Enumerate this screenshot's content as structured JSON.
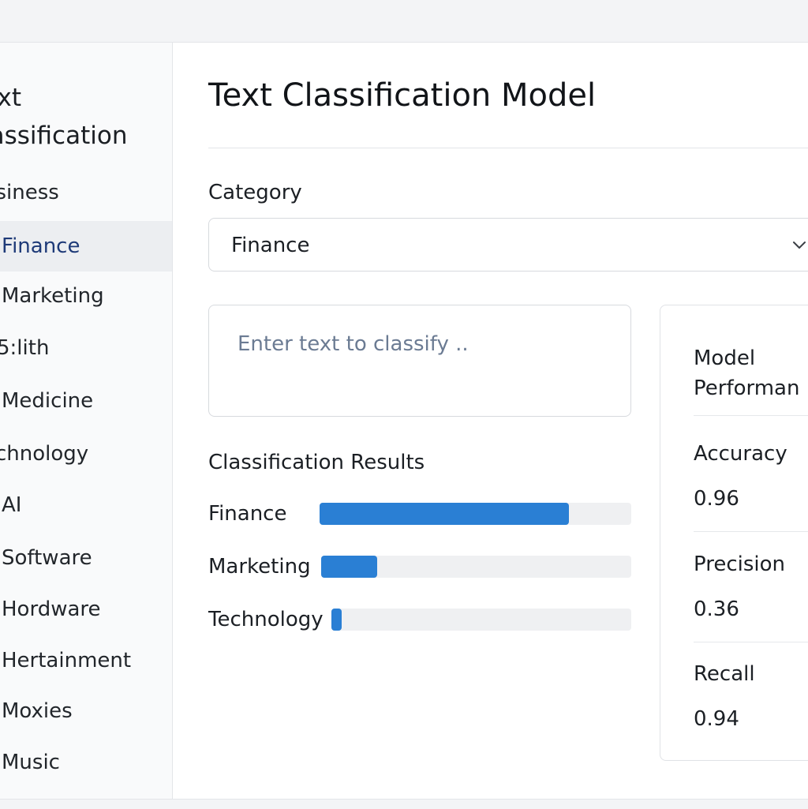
{
  "sidebar": {
    "title": "ext\nlassification",
    "items": [
      {
        "label": "usiness",
        "active": false
      },
      {
        "label": "Finance",
        "active": true
      },
      {
        "label": "Marketing",
        "active": false
      },
      {
        "label": "5:lith",
        "active": false
      },
      {
        "label": "Medicine",
        "active": false
      },
      {
        "label": "chnology",
        "active": false
      },
      {
        "label": "AI",
        "active": false
      },
      {
        "label": "Software",
        "active": false
      },
      {
        "label": "Hordware",
        "active": false
      },
      {
        "label": "Hertainment",
        "active": false
      },
      {
        "label": "Moxies",
        "active": false
      },
      {
        "label": "Music",
        "active": false
      }
    ]
  },
  "main": {
    "title": "Text Classification Model",
    "category": {
      "label": "Category",
      "selected": "Finance"
    },
    "input": {
      "placeholder": "Enter text to classify .."
    },
    "results": {
      "title": "Classification Results",
      "items": [
        {
          "label": "Finance",
          "score": 0.8
        },
        {
          "label": "Marketing",
          "score": 0.18
        },
        {
          "label": "Technology",
          "score": 0.035
        }
      ]
    },
    "performance": {
      "title": "Model\nPerforman",
      "metrics": [
        {
          "label": "Accuracy",
          "value": "0.96"
        },
        {
          "label": "Precision",
          "value": "0.36"
        },
        {
          "label": "Recall",
          "value": "0.94"
        }
      ]
    }
  },
  "colors": {
    "accent": "#2a7fd4",
    "active_item_text": "#1e3a78"
  },
  "icons": {
    "select_chevron": "chevron-down-icon"
  }
}
